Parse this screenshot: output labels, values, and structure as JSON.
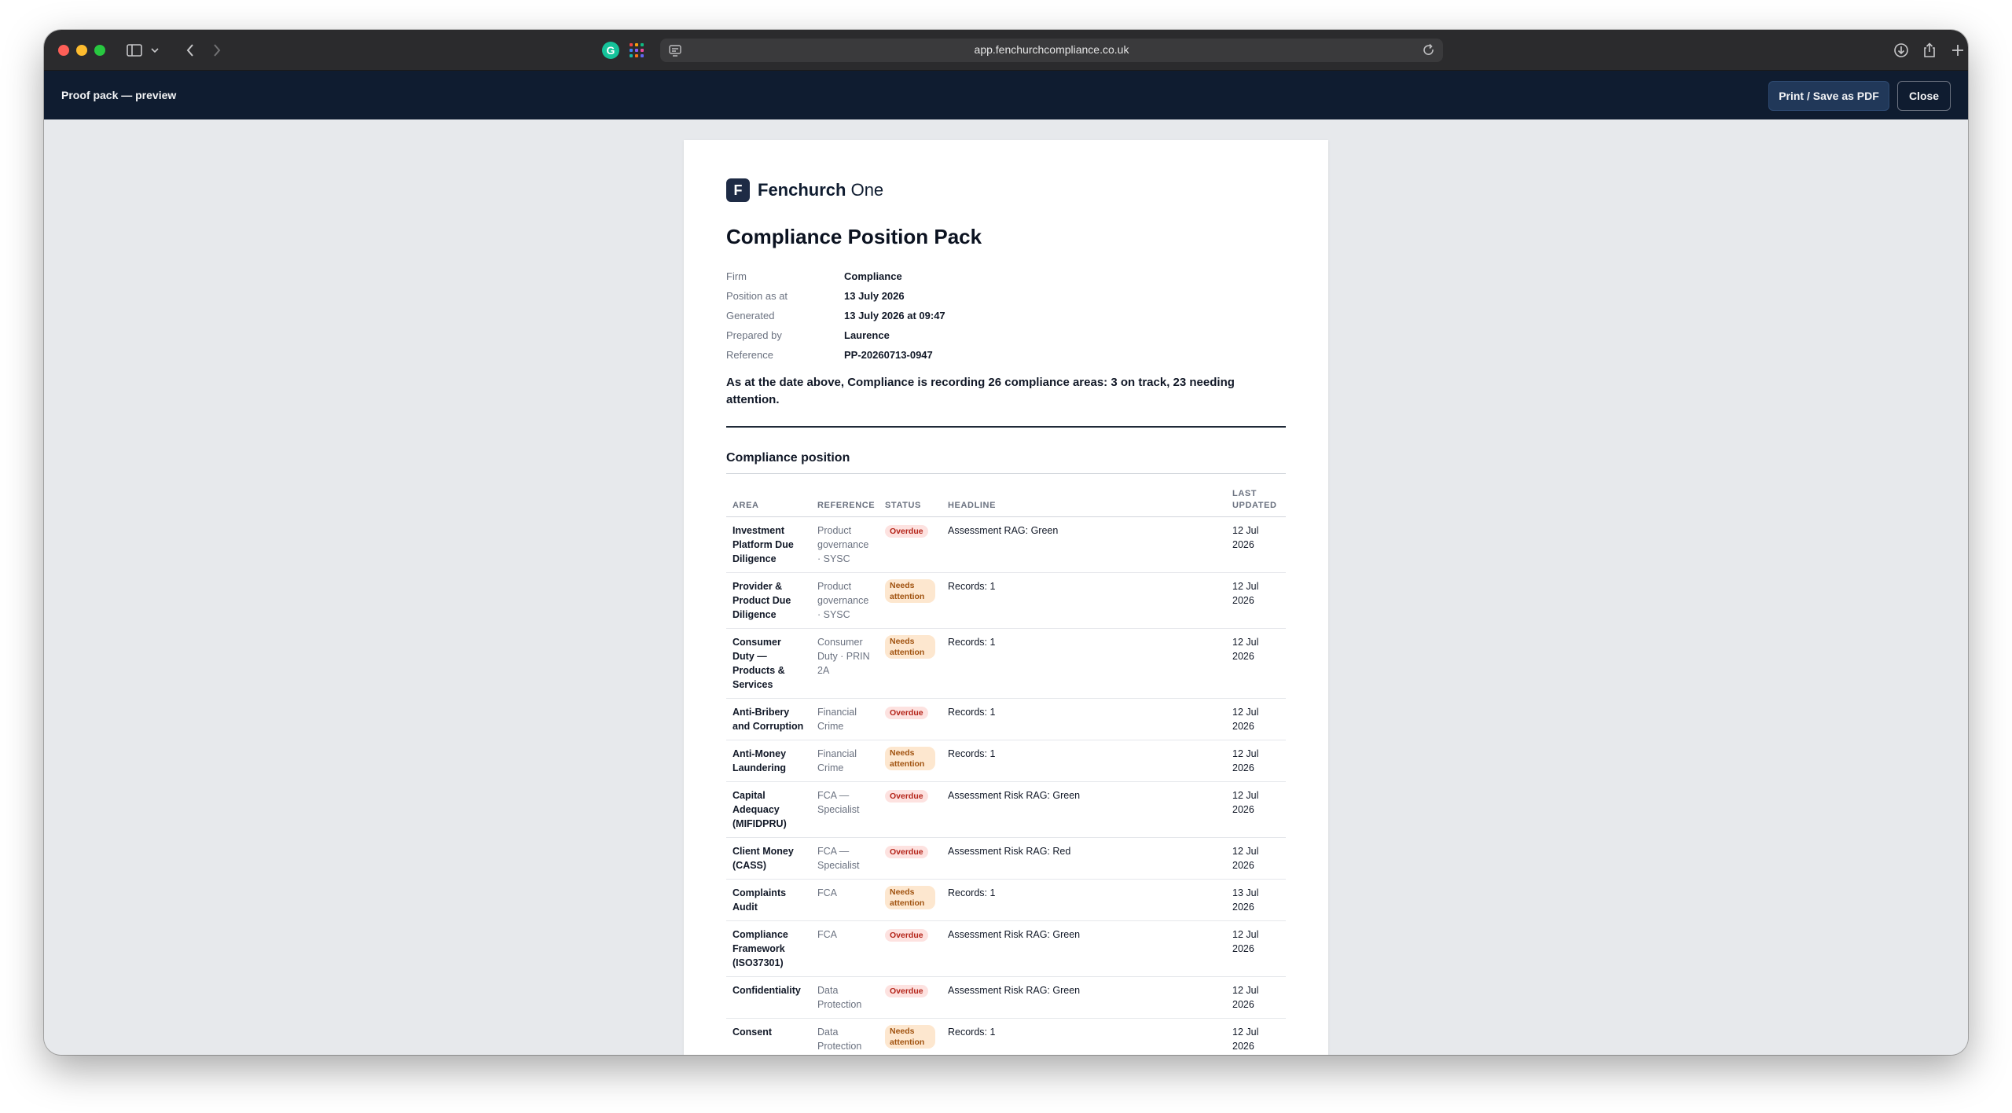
{
  "browser": {
    "url": "app.fenchurchcompliance.co.uk",
    "extension_label": "G"
  },
  "app_header": {
    "title": "Proof pack — preview",
    "print_label": "Print / Save as PDF",
    "close_label": "Close"
  },
  "document": {
    "brand_mark": "F",
    "brand_name_bold": "Fenchurch",
    "brand_name_light": " One",
    "title": "Compliance Position Pack",
    "meta": [
      {
        "label": "Firm",
        "value": "Compliance"
      },
      {
        "label": "Position as at",
        "value": "13 July 2026"
      },
      {
        "label": "Generated",
        "value": "13 July 2026 at 09:47"
      },
      {
        "label": "Prepared by",
        "value": "Laurence"
      },
      {
        "label": "Reference",
        "value": "PP-20260713-0947"
      }
    ],
    "summary": "As at the date above, Compliance is recording 26 compliance areas: 3 on track, 23 needing attention.",
    "section_title": "Compliance position",
    "columns": {
      "area": "AREA",
      "reference": "REFERENCE",
      "status": "STATUS",
      "headline": "HEADLINE",
      "last_updated": "LAST UPDATED"
    },
    "rows": [
      {
        "area": "Investment Platform Due Diligence",
        "reference": "Product governance · SYSC",
        "status": "Overdue",
        "headline": "Assessment RAG: Green",
        "updated": "12 Jul 2026"
      },
      {
        "area": "Provider & Product Due Diligence",
        "reference": "Product governance · SYSC",
        "status": "Needs attention",
        "headline": "Records: 1",
        "updated": "12 Jul 2026"
      },
      {
        "area": "Consumer Duty — Products & Services",
        "reference": "Consumer Duty · PRIN 2A",
        "status": "Needs attention",
        "headline": "Records: 1",
        "updated": "12 Jul 2026"
      },
      {
        "area": "Anti-Bribery and Corruption",
        "reference": "Financial Crime",
        "status": "Overdue",
        "headline": "Records: 1",
        "updated": "12 Jul 2026"
      },
      {
        "area": "Anti-Money Laundering",
        "reference": "Financial Crime",
        "status": "Needs attention",
        "headline": "Records: 1",
        "updated": "12 Jul 2026"
      },
      {
        "area": "Capital Adequacy (MIFIDPRU)",
        "reference": "FCA — Specialist",
        "status": "Overdue",
        "headline": "Assessment Risk RAG: Green",
        "updated": "12 Jul 2026"
      },
      {
        "area": "Client Money (CASS)",
        "reference": "FCA — Specialist",
        "status": "Overdue",
        "headline": "Assessment Risk RAG: Red",
        "updated": "12 Jul 2026"
      },
      {
        "area": "Complaints Audit",
        "reference": "FCA",
        "status": "Needs attention",
        "headline": "Records: 1",
        "updated": "13 Jul 2026"
      },
      {
        "area": "Compliance Framework (ISO37301)",
        "reference": "FCA",
        "status": "Overdue",
        "headline": "Assessment Risk RAG: Green",
        "updated": "12 Jul 2026"
      },
      {
        "area": "Confidentiality",
        "reference": "Data Protection",
        "status": "Overdue",
        "headline": "Assessment Risk RAG: Green",
        "updated": "12 Jul 2026"
      },
      {
        "area": "Consent",
        "reference": "Data Protection",
        "status": "Needs attention",
        "headline": "Records: 1",
        "updated": "12 Jul 2026"
      }
    ]
  },
  "colors": {
    "app_header_bg": "#0f1c30",
    "overdue_bg": "#fde2e0",
    "overdue_text": "#b42318",
    "needs_bg": "#fde7cf",
    "needs_text": "#a15310"
  }
}
